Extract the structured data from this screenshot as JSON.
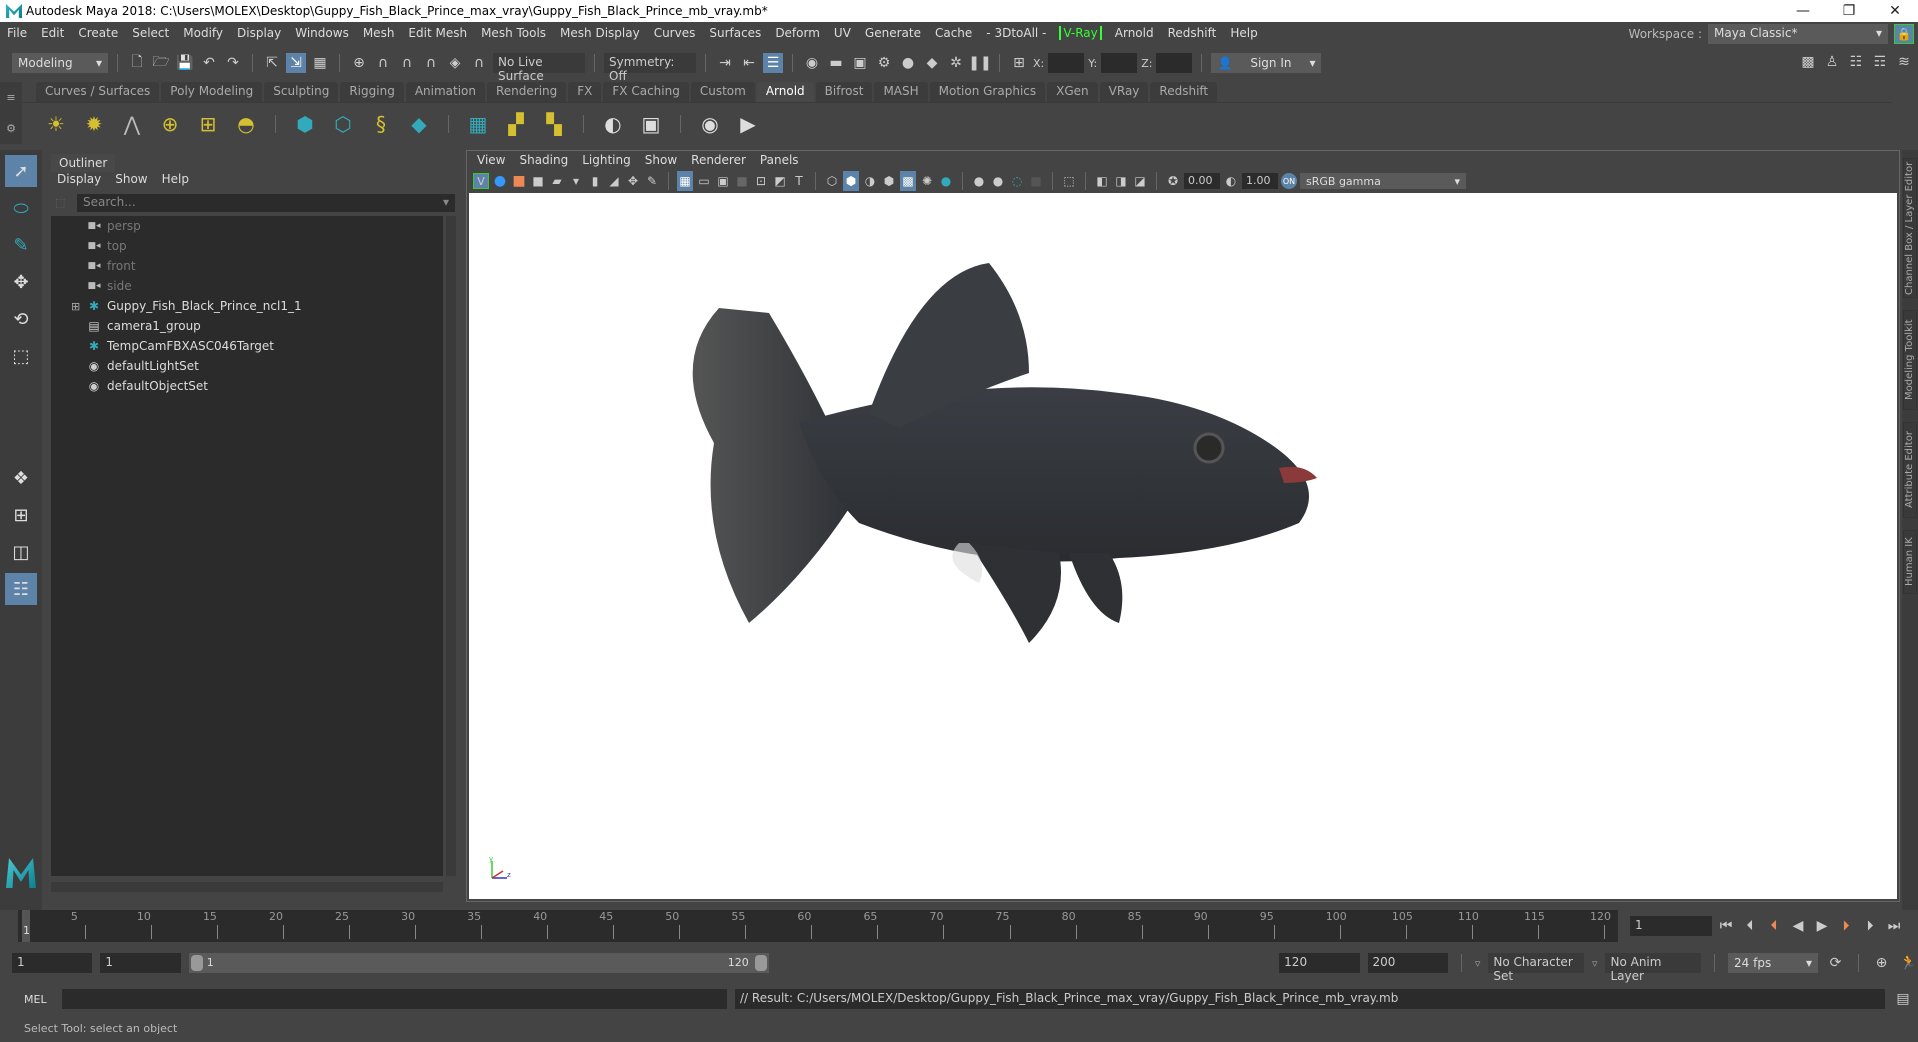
{
  "window": {
    "title": "Autodesk Maya 2018: C:\\Users\\MOLEX\\Desktop\\Guppy_Fish_Black_Prince_max_vray\\Guppy_Fish_Black_Prince_mb_vray.mb*",
    "minimize": "—",
    "restore": "❐",
    "close": "✕"
  },
  "menubar": {
    "items": [
      "File",
      "Edit",
      "Create",
      "Select",
      "Modify",
      "Display",
      "Windows",
      "Mesh",
      "Edit Mesh",
      "Mesh Tools",
      "Mesh Display",
      "Curves",
      "Surfaces",
      "Deform",
      "UV",
      "Generate",
      "Cache",
      "- 3DtoAll -"
    ],
    "vray": "V-Ray",
    "items2": [
      "Arnold",
      "Redshift",
      "Help"
    ]
  },
  "workspace": {
    "label": "Workspace :",
    "value": "Maya Classic*"
  },
  "statusline": {
    "mode": "Modeling",
    "live_surface": "No Live Surface",
    "symmetry": "Symmetry: Off",
    "x_label": "X:",
    "y_label": "Y:",
    "z_label": "Z:",
    "sign_in": "Sign In"
  },
  "shelf": {
    "tabs": [
      "Curves / Surfaces",
      "Poly Modeling",
      "Sculpting",
      "Rigging",
      "Animation",
      "Rendering",
      "FX",
      "FX Caching",
      "Custom",
      "Arnold",
      "Bifrost",
      "MASH",
      "Motion Graphics",
      "XGen",
      "VRay",
      "Redshift"
    ],
    "active": "Arnold"
  },
  "outliner": {
    "tab": "Outliner",
    "menu": [
      "Display",
      "Show",
      "Help"
    ],
    "search_placeholder": "Search...",
    "items": [
      {
        "label": "persp",
        "icon": "camera-icon",
        "dim": true
      },
      {
        "label": "top",
        "icon": "camera-icon",
        "dim": true
      },
      {
        "label": "front",
        "icon": "camera-icon",
        "dim": true
      },
      {
        "label": "side",
        "icon": "camera-icon",
        "dim": true
      },
      {
        "label": "Guppy_Fish_Black_Prince_ncl1_1",
        "icon": "joint-icon",
        "expandable": true
      },
      {
        "label": "camera1_group",
        "icon": "group-icon"
      },
      {
        "label": "TempCamFBXASC046Target",
        "icon": "joint-icon"
      },
      {
        "label": "defaultLightSet",
        "icon": "set-icon"
      },
      {
        "label": "defaultObjectSet",
        "icon": "set-icon"
      }
    ]
  },
  "viewport": {
    "menu": [
      "View",
      "Shading",
      "Lighting",
      "Show",
      "Renderer",
      "Panels"
    ],
    "exposure": "0.00",
    "gamma": "1.00",
    "color_space": "sRGB gamma"
  },
  "right_tabs": [
    "Channel Box / Layer Editor",
    "Modeling Toolkit",
    "Attribute Editor",
    "Human IK"
  ],
  "timeline": {
    "ticks": [
      5,
      10,
      15,
      20,
      25,
      30,
      35,
      40,
      45,
      50,
      55,
      60,
      65,
      70,
      75,
      80,
      85,
      90,
      95,
      100,
      105,
      110,
      115,
      120
    ],
    "current_label": "1",
    "current_frame": "1",
    "min": 1,
    "max": 120
  },
  "range": {
    "start": "1",
    "anim_start": "1",
    "slider_start": "1",
    "slider_end": "120",
    "end": "120",
    "anim_end": "200",
    "character_set": "No Character Set",
    "anim_layer": "No Anim Layer",
    "fps": "24 fps"
  },
  "command": {
    "lang": "MEL",
    "result": "// Result: C:/Users/MOLEX/Desktop/Guppy_Fish_Black_Prince_max_vray/Guppy_Fish_Black_Prince_mb_vray.mb"
  },
  "help_line": "Select Tool: select an object",
  "colors": {
    "accent": "#5d83a8",
    "vray_green": "#33ff33",
    "teal": "#2fb3c0"
  }
}
